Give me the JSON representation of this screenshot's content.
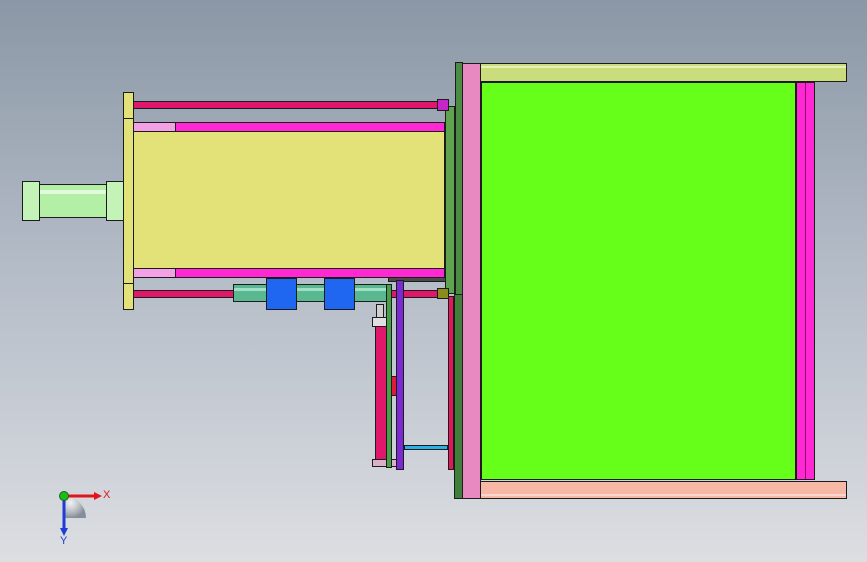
{
  "viewport": {
    "background_top": "#8b97a6",
    "background_bottom": "#dcdee2"
  },
  "colors": {
    "green_panel": "#66ff1a",
    "rail_top": "#c9dd7d",
    "rail_bottom": "#f7b8a5",
    "magenta": "#ff28d2",
    "pink": "#e889c2",
    "light_pink": "#f3a0e6",
    "yellow_body": "#e2e278",
    "crimson_rod": "#e0186b",
    "cylinder_green": "#b3f0a6",
    "teal": "#5ab891",
    "blue_block": "#1f66f0",
    "dark_green": "#4b8c45",
    "violet": "#7a2ad0",
    "cyan": "#2ab0e8"
  },
  "triad": {
    "x_label": "X",
    "y_label": "Y",
    "x_color": "#e0141e",
    "y_color": "#1f3cd6",
    "z_color": "#1fb81f"
  }
}
